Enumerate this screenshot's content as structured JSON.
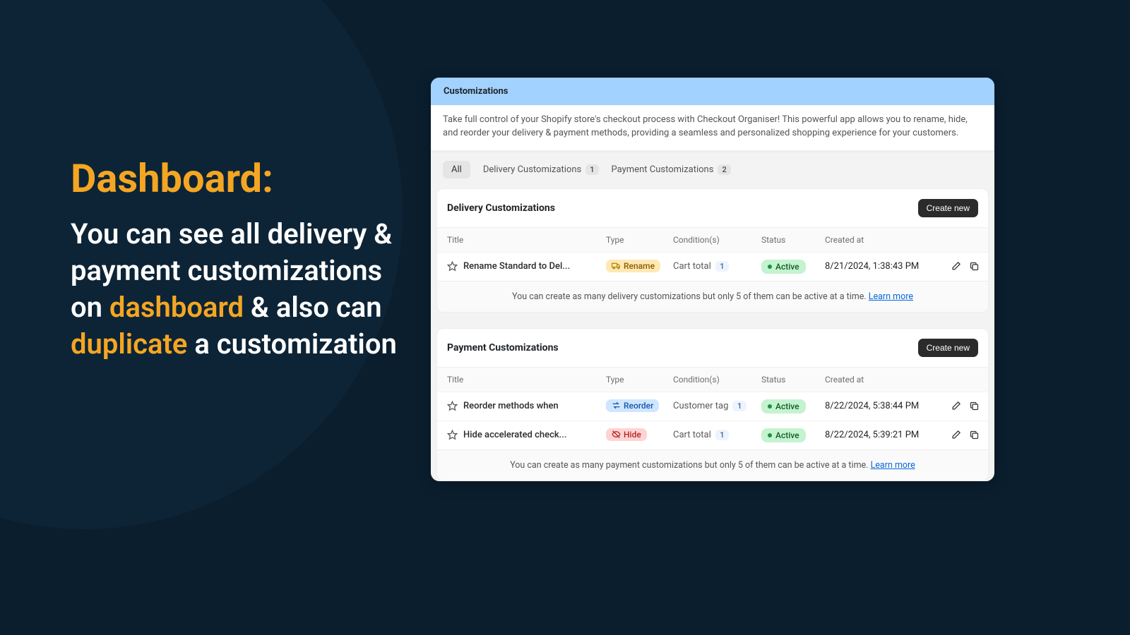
{
  "left": {
    "title": "Dashboard:",
    "l1": "You can see all delivery & payment customizations on ",
    "hl1": "dashboard",
    "l2": " & also can ",
    "hl2": "duplicate",
    "l3": " a customization"
  },
  "app": {
    "header": "Customizations",
    "intro": "Take full control of your Shopify store's checkout process with Checkout Organiser! This powerful app allows you to rename, hide, and reorder your delivery & payment methods, providing a seamless and personalized shopping experience for your customers."
  },
  "tabs": {
    "all": "All",
    "delivery": "Delivery Customizations",
    "delivery_count": "1",
    "payment": "Payment Customizations",
    "payment_count": "2"
  },
  "tableHeaders": {
    "title": "Title",
    "type": "Type",
    "conditions": "Condition(s)",
    "status": "Status",
    "created": "Created at"
  },
  "deliverySection": {
    "title": "Delivery Customizations",
    "create": "Create new",
    "rows": [
      {
        "title": "Rename Standard to Del...",
        "type": "Rename",
        "condition": "Cart total",
        "condCount": "1",
        "status": "Active",
        "created": "8/21/2024, 1:38:43 PM"
      }
    ],
    "footer": "You can create as many delivery customizations but only 5 of them can be active at a time. ",
    "learn": "Learn more"
  },
  "paymentSection": {
    "title": "Payment Customizations",
    "create": "Create new",
    "rows": [
      {
        "title": "Reorder methods when",
        "type": "Reorder",
        "condition": "Customer tag",
        "condCount": "1",
        "status": "Active",
        "created": "8/22/2024, 5:38:44 PM"
      },
      {
        "title": "Hide accelerated check...",
        "type": "Hide",
        "condition": "Cart total",
        "condCount": "1",
        "status": "Active",
        "created": "8/22/2024, 5:39:21 PM"
      }
    ],
    "footer": "You can create as many payment customizations but only 5 of them can be active at a time. ",
    "learn": "Learn more"
  }
}
